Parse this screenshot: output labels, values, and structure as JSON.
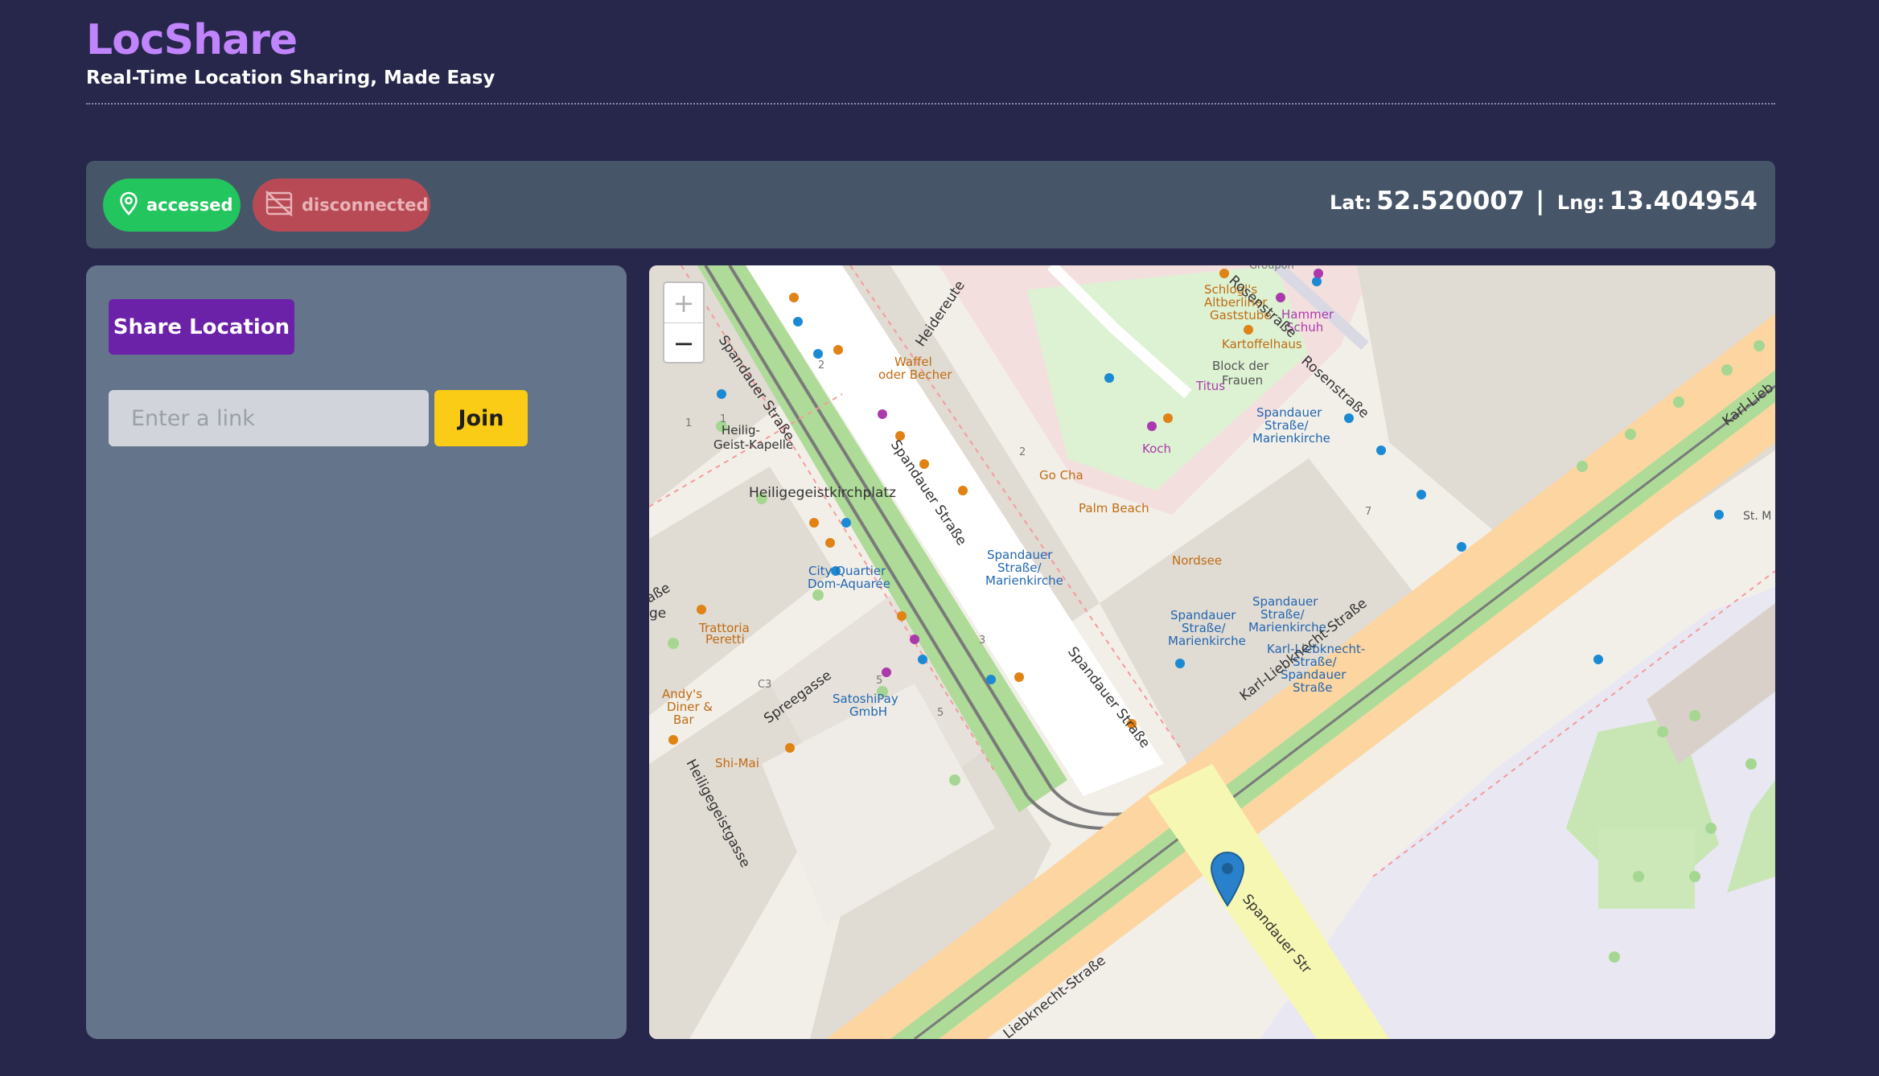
{
  "app": {
    "title": "LocShare",
    "subtitle": "Real-Time Location Sharing, Made Easy"
  },
  "status": {
    "location_badge": {
      "label": "accessed",
      "icon": "map-pin-icon",
      "color": "#22c55e"
    },
    "connection_badge": {
      "label": "disconnected",
      "icon": "link-off-icon",
      "color": "#b84a55"
    },
    "lat_label": "Lat:",
    "lat_value": "52.520007",
    "separator": "|",
    "lng_label": "Lng:",
    "lng_value": "13.404954"
  },
  "controls": {
    "share_label": "Share Location",
    "link_placeholder": "Enter a link",
    "link_value": "",
    "join_label": "Join"
  },
  "map": {
    "zoom_in": "+",
    "zoom_out": "−",
    "streets": [
      "Spandauer Straße",
      "Spandauer Straße",
      "Spandauer Straße",
      "Spandauer Straße",
      "Spandauer Str",
      "Karl-Liebknecht-Straße",
      "Liebknecht-Straße",
      "Karl-Lieb",
      "Heidereute",
      "Rosenstraße",
      "Rosenstraße",
      "Spreegasse",
      "Heiligegeistgasse",
      "Heiligegeistkirchplatz",
      "aße",
      "ge",
      "Groupon"
    ],
    "places": [
      "Heilig-",
      "Geist-Kapelle",
      "Waffel",
      "oder Becher",
      "Go Cha",
      "Palm Beach",
      "Block der",
      "Frauen",
      "Schlogl's",
      "Altberliner",
      "Gaststube",
      "Hammer",
      "Schuh",
      "Kartoffelhaus",
      "Titus",
      "Koch",
      "Nordsee",
      "City Quartier",
      "Dom-Aquarée",
      "Trattoria",
      "Peretti",
      "Andy's",
      "Diner &",
      "Bar",
      "Shi-Mai",
      "SatoshiPay",
      "GmbH",
      "C3",
      "St. M"
    ],
    "stops": [
      "Spandauer",
      "Straße/",
      "Marienkirche",
      "Spandauer",
      "Straße/",
      "Marienkirche",
      "Spandauer",
      "Straße/",
      "Marienkirche",
      "Spandauer",
      "Straße/",
      "Marienkirche",
      "Karl-Liebknecht-",
      "Straße/",
      "Spandauer",
      "Straße"
    ],
    "house_numbers": [
      "1",
      "1",
      "2",
      "2",
      "3",
      "5",
      "5",
      "7"
    ],
    "marker_icon": "map-marker-icon",
    "marker_color": "#2a81cb"
  }
}
